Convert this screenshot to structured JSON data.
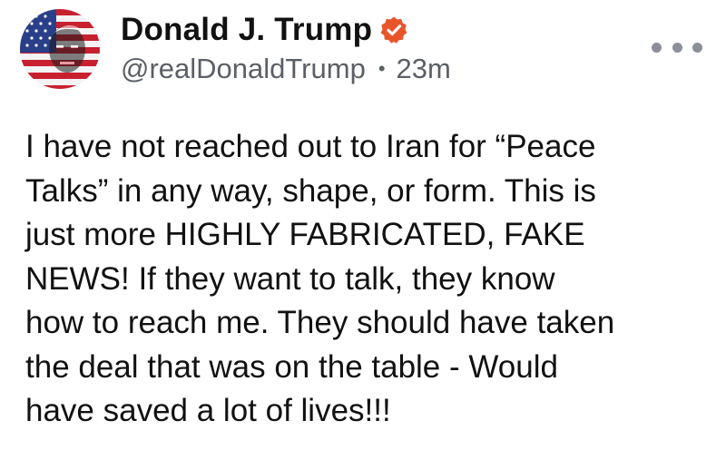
{
  "author": {
    "display_name": "Donald J. Trump",
    "handle": "@realDonaldTrump",
    "separator": "•",
    "time_ago": "23m",
    "verified_icon": "verified-badge-icon",
    "verified_color": "#e8552b"
  },
  "actions": {
    "more_icon": "more-horizontal-icon"
  },
  "post": {
    "lines": [
      "I have not reached out to Iran for “Peace",
      "Talks” in any way, shape, or form. This is",
      "just more HIGHLY FABRICATED, FAKE",
      "NEWS! If they want to talk, they know",
      "how to reach me. They should have taken",
      "the deal that was on the table - Would",
      "have saved a lot of lives!!!"
    ]
  }
}
